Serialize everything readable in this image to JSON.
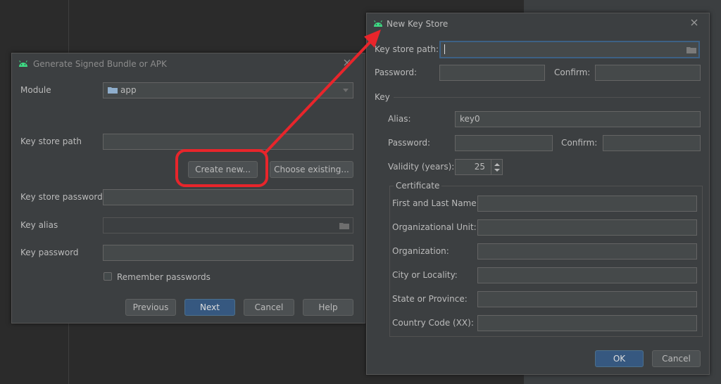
{
  "gen": {
    "title": "Generate Signed Bundle or APK",
    "module_label": "Module",
    "module_value": "app",
    "keystore_path_label": "Key store path",
    "create_new": "Create new...",
    "choose_existing": "Choose existing...",
    "keystore_password_label": "Key store password",
    "key_alias_label": "Key alias",
    "key_password_label": "Key password",
    "remember_passwords": "Remember passwords",
    "previous": "Previous",
    "next": "Next",
    "cancel": "Cancel",
    "help": "Help"
  },
  "nks": {
    "title": "New Key Store",
    "keystore_path_label": "Key store path:",
    "password_label": "Password:",
    "confirm_label": "Confirm:",
    "key_section": "Key",
    "alias_label": "Alias:",
    "alias_value": "key0",
    "key_password_label": "Password:",
    "key_confirm_label": "Confirm:",
    "validity_label": "Validity (years):",
    "validity_value": "25",
    "certificate_label": "Certificate",
    "first_last_label": "First and Last Name:",
    "org_unit_label": "Organizational Unit:",
    "org_label": "Organization:",
    "city_label": "City or Locality:",
    "state_label": "State or Province:",
    "country_label": "Country Code (XX):",
    "ok": "OK",
    "cancel": "Cancel"
  },
  "colors": {
    "annotation": "#e8252b",
    "android_green": "#3ddc84",
    "primary_button": "#365880"
  },
  "icons": [
    "android-icon",
    "close-icon",
    "folder-icon",
    "dropdown-arrow-icon",
    "spinner-icon"
  ]
}
